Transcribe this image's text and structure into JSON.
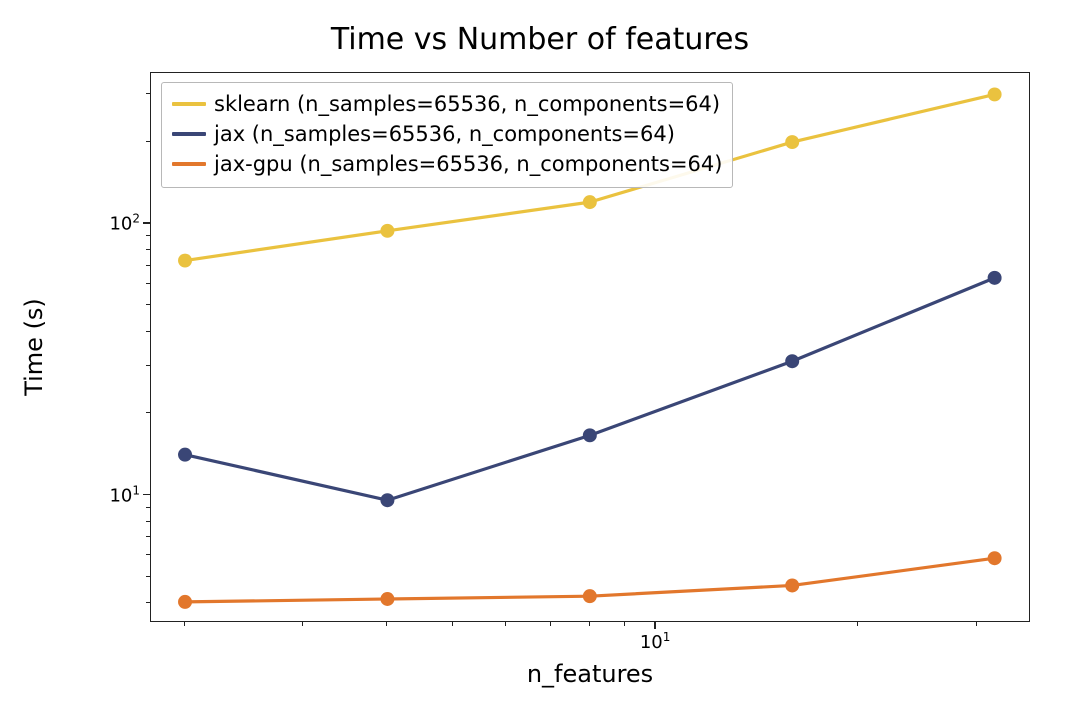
{
  "chart_data": {
    "type": "line",
    "title": "Time vs Number of features",
    "xlabel": "n_features",
    "ylabel": "Time (s)",
    "xscale": "log",
    "yscale": "log",
    "x": [
      2,
      4,
      8,
      16,
      32
    ],
    "series": [
      {
        "name": "sklearn (n_samples=65536, n_components=64)",
        "color": "#eac23f",
        "values": [
          73,
          94,
          120,
          200,
          300
        ]
      },
      {
        "name": "jax (n_samples=65536, n_components=64)",
        "color": "#3a4676",
        "values": [
          14,
          9.5,
          16.5,
          31,
          63
        ]
      },
      {
        "name": "jax-gpu (n_samples=65536, n_components=64)",
        "color": "#e2772c",
        "values": [
          4.0,
          4.1,
          4.2,
          4.6,
          5.8
        ]
      }
    ],
    "xlim": [
      1.78,
      36
    ],
    "ylim": [
      3.4,
      360
    ],
    "x_major_ticks": [
      10
    ],
    "y_major_ticks": [
      10,
      100
    ],
    "x_tick_labels": {
      "10": "10^1"
    },
    "y_tick_labels": {
      "10": "10^1",
      "100": "10^2"
    }
  }
}
